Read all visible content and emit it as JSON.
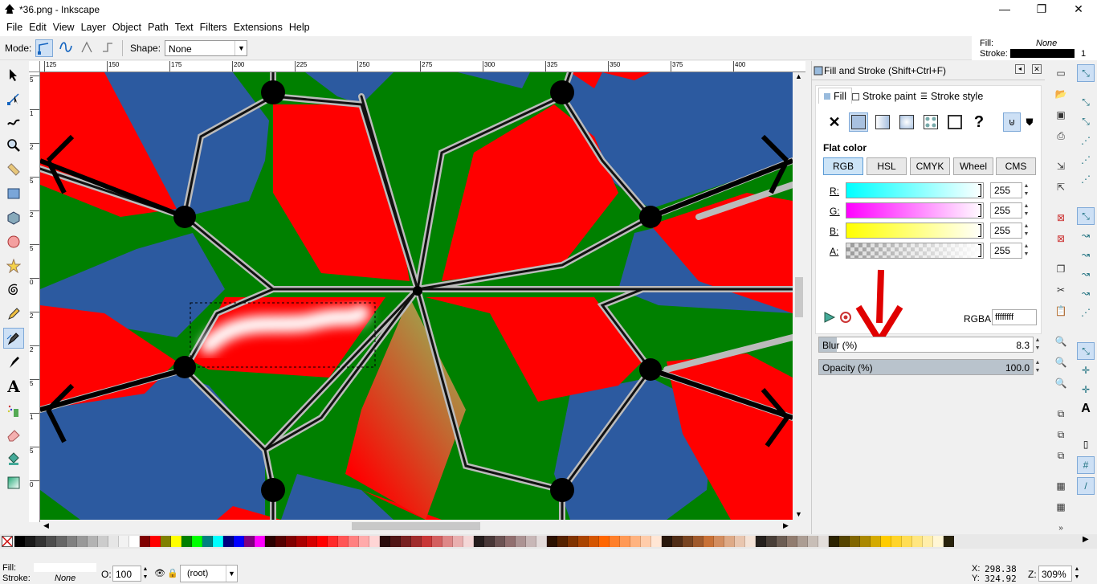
{
  "window": {
    "title": "*36.png - Inkscape",
    "minimize": "—",
    "maximize": "❐",
    "close": "✕"
  },
  "menu": [
    "File",
    "Edit",
    "View",
    "Layer",
    "Object",
    "Path",
    "Text",
    "Filters",
    "Extensions",
    "Help"
  ],
  "toolbar": {
    "mode_label": "Mode:",
    "shape_label": "Shape:",
    "shape_value": "None"
  },
  "indicator": {
    "fill_label": "Fill:",
    "fill_value": "None",
    "stroke_label": "Stroke:",
    "stroke_width": "1"
  },
  "ruler": {
    "h_ticks": [
      "125",
      "150",
      "175",
      "200",
      "225",
      "250",
      "275",
      "300",
      "325",
      "350",
      "375",
      "400"
    ],
    "v_ticks": [
      "5",
      "1",
      "2",
      "5",
      "2",
      "5",
      "0",
      "2",
      "2",
      "5",
      "1",
      "5",
      "0"
    ]
  },
  "panel": {
    "title": "Fill and Stroke (Shift+Ctrl+F)",
    "tabs": [
      "Fill",
      "Stroke paint",
      "Stroke style"
    ],
    "section_title": "Flat color",
    "modes": [
      "RGB",
      "HSL",
      "CMYK",
      "Wheel",
      "CMS"
    ],
    "channels": [
      {
        "label": "R:",
        "value": "255"
      },
      {
        "label": "G:",
        "value": "255"
      },
      {
        "label": "B:",
        "value": "255"
      },
      {
        "label": "A:",
        "value": "255"
      }
    ],
    "rgba_label": "RGBA:",
    "rgba_value": "ffffffff",
    "blur_label": "Blur (%)",
    "blur_value": "8.3",
    "opacity_label": "Opacity (%)",
    "opacity_value": "100.0",
    "opacity_fraction": 1.0,
    "blur_fraction": 0.083
  },
  "status": {
    "fill_label": "Fill:",
    "stroke_label": "Stroke:",
    "stroke_value": "None",
    "opacity_label": "O:",
    "opacity_value": "100",
    "layer_value": "(root)",
    "x_label": "X:",
    "x_value": "298.38",
    "y_label": "Y:",
    "y_value": "324.92",
    "zoom_label": "Z:",
    "zoom_value": "309%"
  },
  "colors": {
    "red": "#ff0000",
    "green": "#008000",
    "blue": "#2c5aa0",
    "accent_arrow": "#e00000"
  },
  "palette": [
    "#000000",
    "#1a1a1a",
    "#333333",
    "#4d4d4d",
    "#666666",
    "#808080",
    "#999999",
    "#b3b3b3",
    "#cccccc",
    "#e6e6e6",
    "#f2f2f2",
    "#ffffff",
    "#800000",
    "#ff0000",
    "#808000",
    "#ffff00",
    "#008000",
    "#00ff00",
    "#008080",
    "#00ffff",
    "#000080",
    "#0000ff",
    "#800080",
    "#ff00ff",
    "#2b0000",
    "#550000",
    "#800000",
    "#aa0000",
    "#d40000",
    "#ff0000",
    "#ff2a2a",
    "#ff5555",
    "#ff8080",
    "#ffaaaa",
    "#ffd5d5",
    "#280b0b",
    "#501616",
    "#782121",
    "#a02c2c",
    "#c83737",
    "#d35f5f",
    "#de8787",
    "#e9afaf",
    "#f4d7d7",
    "#241c1c",
    "#483737",
    "#6c5353",
    "#916f6f",
    "#ac9393",
    "#c8b7b7",
    "#e3dbdb",
    "#2b1100",
    "#552200",
    "#803300",
    "#aa4400",
    "#d45500",
    "#ff6600",
    "#ff7f2a",
    "#ff9955",
    "#ffb380",
    "#ffccaa",
    "#ffe6d5",
    "#28170b",
    "#502d16",
    "#784421",
    "#a05a2c",
    "#c87137",
    "#d38d5f",
    "#deaa87",
    "#e9c6af",
    "#f4e3d7",
    "#241f1c",
    "#483e37",
    "#6c5d53",
    "#917c6f",
    "#ac9d93",
    "#c8beb7",
    "#e3dedb",
    "#2b2200",
    "#554400",
    "#806600",
    "#aa8800",
    "#d4aa00",
    "#ffcc00",
    "#ffd42a",
    "#ffdd55",
    "#ffe680",
    "#ffeeaa",
    "#fff6d5",
    "#28220b"
  ]
}
